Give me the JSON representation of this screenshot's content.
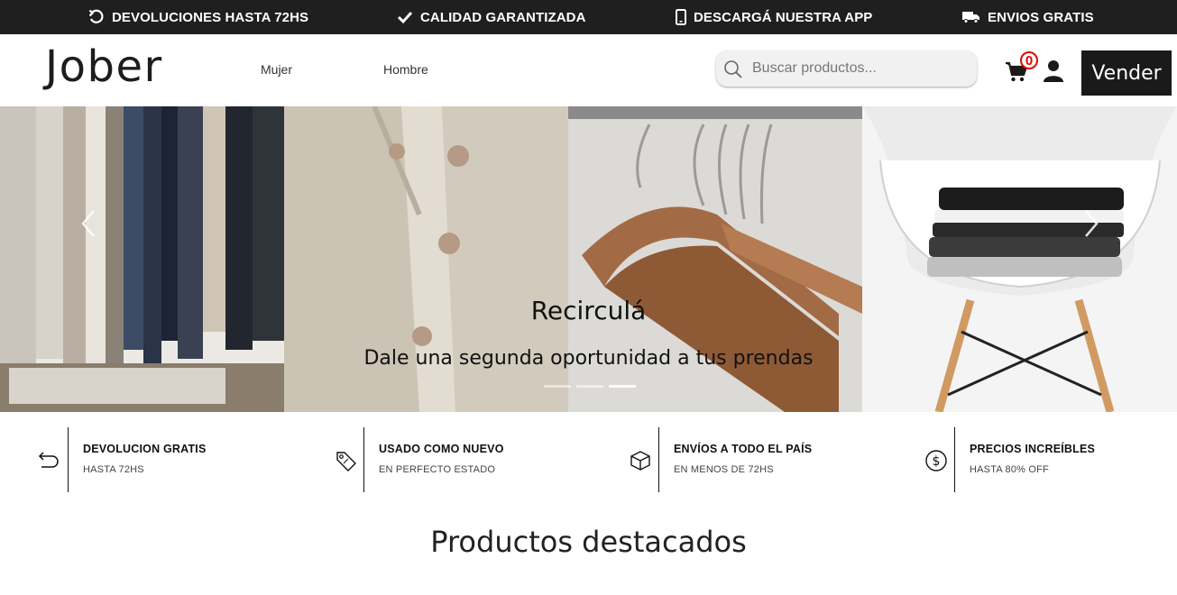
{
  "topbar": {
    "items": [
      {
        "icon": "return-arrow-icon",
        "label": "DEVOLUCIONES HASTA 72HS"
      },
      {
        "icon": "check-icon",
        "label": "CALIDAD GARANTIZADA"
      },
      {
        "icon": "mobile-phone-icon",
        "label": "DESCARGÁ NUESTRA APP"
      },
      {
        "icon": "truck-icon",
        "label": "ENVIOS GRATIS"
      }
    ]
  },
  "header": {
    "logo": "Jober",
    "nav": [
      "Mujer",
      "Hombre"
    ],
    "search_placeholder": "Buscar productos...",
    "cart_count": "0",
    "sell_button": "Vender"
  },
  "hero": {
    "title": "Recirculá",
    "subtitle": "Dale una segunda oportunidad a tus prendas",
    "slides": 3,
    "active_slide": 3
  },
  "features": [
    {
      "icon": "return-arrow-icon",
      "title": "DEVOLUCION GRATIS",
      "subtitle": "HASTA 72HS"
    },
    {
      "icon": "price-tag-icon",
      "title": "USADO COMO NUEVO",
      "subtitle": "EN PERFECTO ESTADO"
    },
    {
      "icon": "box-icon",
      "title": "ENVÍOS A TODO EL PAÍS",
      "subtitle": "EN MENOS DE 72HS"
    },
    {
      "icon": "dollar-coin-icon",
      "title": "PRECIOS INCREÍBLES",
      "subtitle": "HASTA 80% OFF"
    }
  ],
  "section": {
    "title": "Productos destacados"
  },
  "colors": {
    "topbar_bg": "#1f1f1f",
    "badge": "#e10600",
    "button_bg": "#1a1a1a"
  }
}
